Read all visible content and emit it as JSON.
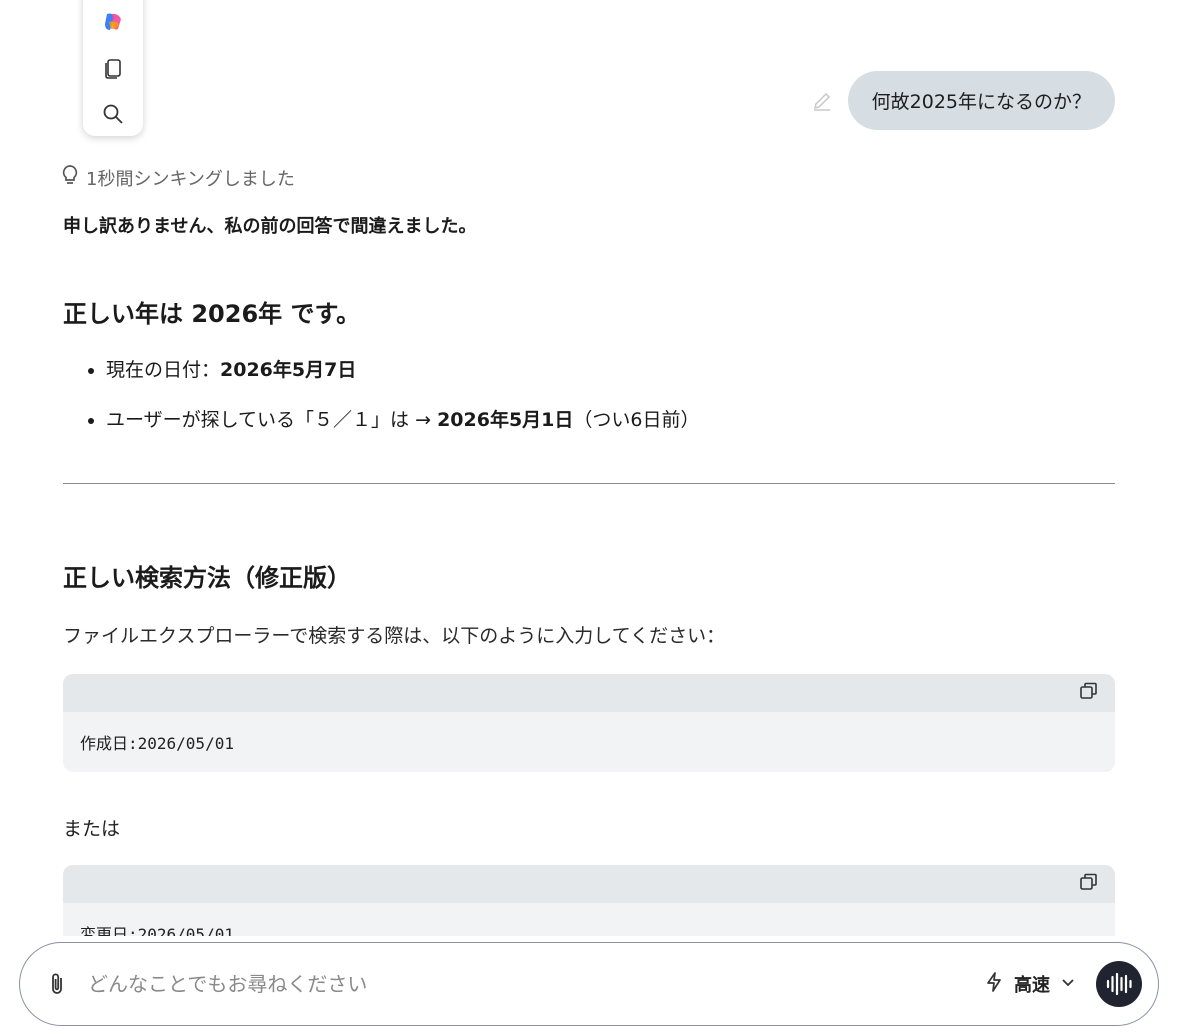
{
  "user_message": "何故2025年になるのか？",
  "thinking": {
    "label": "1秒間シンキングしました"
  },
  "answer": {
    "apology": "申し訳ありません、私の前の回答で間違えました。",
    "heading_year": "正しい年は 2026年 です。",
    "facts": [
      {
        "prefix": "現在の日付：",
        "bold": "2026年5月7日",
        "suffix": ""
      },
      {
        "prefix": "ユーザーが探している「５／１」は → ",
        "bold": "2026年5月1日",
        "suffix": "（つい6日前）"
      }
    ],
    "heading_search": "正しい検索方法（修正版）",
    "intro": "ファイルエクスプローラーで検索する際は、以下のように入力してください：",
    "code1": "作成日:2026/05/01",
    "or_text": "または",
    "code2": "変更日:2026/05/01"
  },
  "composer": {
    "placeholder": "どんなことでもお尋ねください",
    "mode_label": "高速"
  },
  "colors": {
    "user_bubble": "#d6dde3",
    "code_header": "#e4e8eb",
    "code_body": "#f1f3f4",
    "voice_button": "#1f2430"
  }
}
